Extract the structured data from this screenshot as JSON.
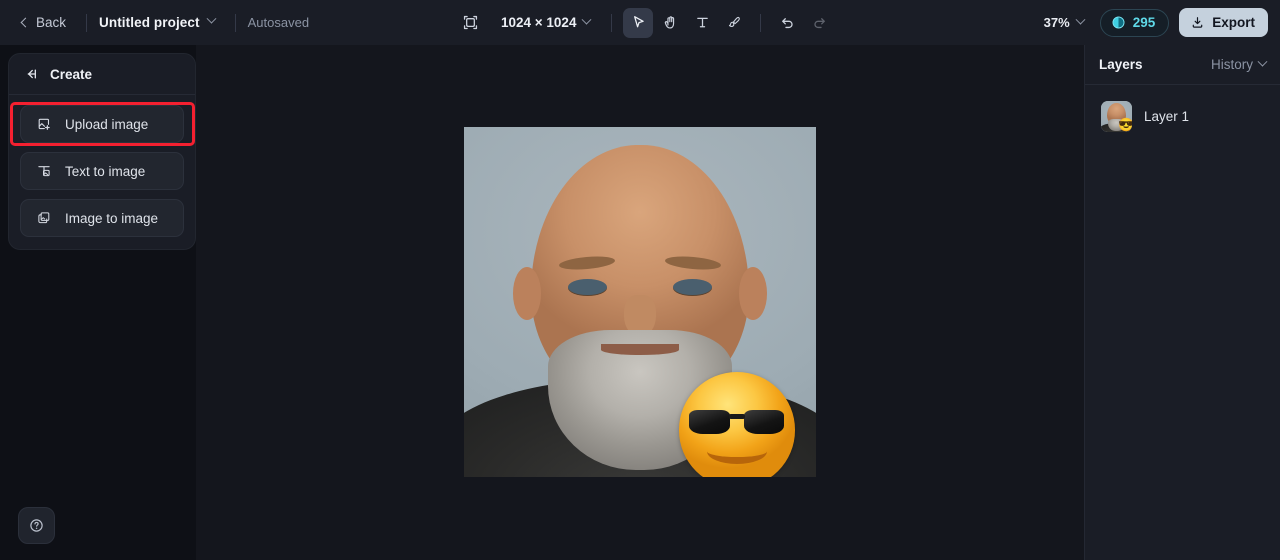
{
  "topbar": {
    "back_label": "Back",
    "project_title": "Untitled project",
    "autosave_label": "Autosaved",
    "canvas_size_label": "1024 × 1024",
    "zoom_label": "37%",
    "credits_value": "295",
    "export_label": "Export",
    "tools": [
      {
        "name": "select-tool",
        "glyph": "cursor",
        "active": true
      },
      {
        "name": "hand-tool",
        "glyph": "hand",
        "active": false
      },
      {
        "name": "text-tool",
        "glyph": "T",
        "active": false
      },
      {
        "name": "brush-tool",
        "glyph": "brush",
        "active": false
      }
    ],
    "undo_label": "Undo",
    "redo_label": "Redo"
  },
  "left_panel": {
    "title": "Create",
    "items": [
      {
        "label": "Upload image",
        "icon": "upload-image-icon",
        "highlighted": true
      },
      {
        "label": "Text to image",
        "icon": "text-to-image-icon",
        "highlighted": false
      },
      {
        "label": "Image to image",
        "icon": "image-to-image-icon",
        "highlighted": false
      }
    ]
  },
  "right_panel": {
    "layers_tab": "Layers",
    "history_tab": "History",
    "layers": [
      {
        "name": "Layer 1"
      }
    ]
  },
  "canvas": {
    "emoji": "😎",
    "background_color": "#a3b0b7"
  },
  "help": {
    "label": "Help"
  },
  "colors": {
    "accent_cyan": "#5fd9e8",
    "annotation_red": "#f42030",
    "panel_bg": "#1a1d26",
    "canvas_bg": "#14161d",
    "export_bg": "#c5d1dd"
  }
}
